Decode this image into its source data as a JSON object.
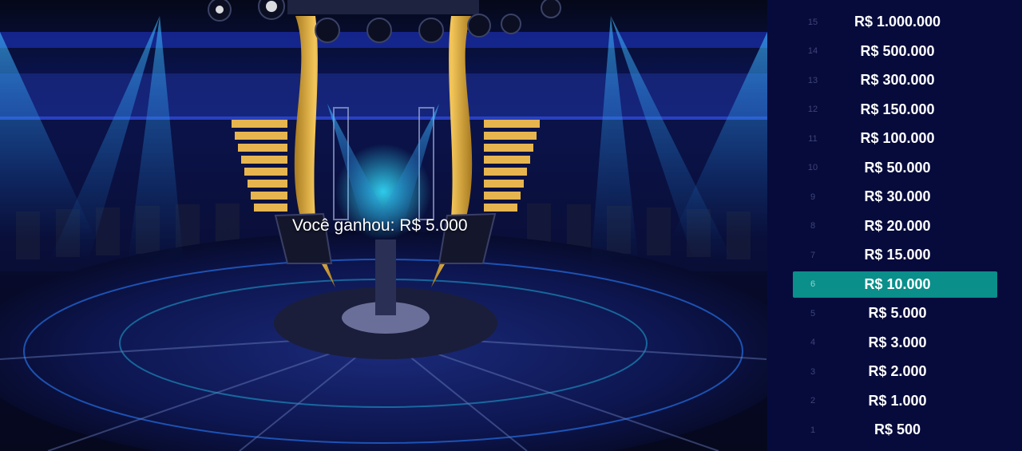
{
  "game": {
    "win_message": "Você ganhou: R$ 5.000"
  },
  "ladder": {
    "current_level": 6,
    "highlight_color": "#0a8f8a",
    "levels": [
      {
        "number": "15",
        "amount": "R$ 1.000.000"
      },
      {
        "number": "14",
        "amount": "R$ 500.000"
      },
      {
        "number": "13",
        "amount": "R$ 300.000"
      },
      {
        "number": "12",
        "amount": "R$ 150.000"
      },
      {
        "number": "11",
        "amount": "R$ 100.000"
      },
      {
        "number": "10",
        "amount": "R$ 50.000"
      },
      {
        "number": "9",
        "amount": "R$ 30.000"
      },
      {
        "number": "8",
        "amount": "R$ 20.000"
      },
      {
        "number": "7",
        "amount": "R$ 15.000"
      },
      {
        "number": "6",
        "amount": "R$ 10.000"
      },
      {
        "number": "5",
        "amount": "R$ 5.000"
      },
      {
        "number": "4",
        "amount": "R$ 3.000"
      },
      {
        "number": "3",
        "amount": "R$ 2.000"
      },
      {
        "number": "2",
        "amount": "R$ 1.000"
      },
      {
        "number": "1",
        "amount": "R$ 500"
      }
    ]
  }
}
